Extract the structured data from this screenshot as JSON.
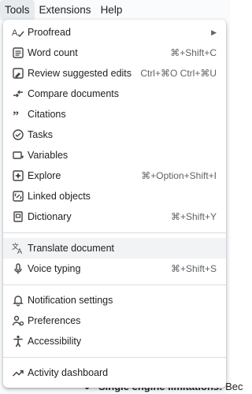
{
  "menubar": {
    "items": [
      "Tools",
      "Extensions",
      "Help"
    ]
  },
  "menu": {
    "items": [
      {
        "label": "Proofread",
        "shortcut": "",
        "submenu_glyph": "▶",
        "icon": "proofread-icon"
      },
      {
        "label": "Word count",
        "shortcut": "⌘+Shift+C",
        "icon": "word-count-icon"
      },
      {
        "label": "Review suggested edits",
        "shortcut": "Ctrl+⌘O Ctrl+⌘U",
        "icon": "review-edits-icon"
      },
      {
        "label": "Compare documents",
        "shortcut": "",
        "icon": "compare-icon"
      },
      {
        "label": "Citations",
        "shortcut": "",
        "icon": "quote-icon"
      },
      {
        "label": "Tasks",
        "shortcut": "",
        "icon": "tasks-check-icon"
      },
      {
        "label": "Variables",
        "shortcut": "",
        "icon": "variables-icon"
      },
      {
        "label": "Explore",
        "shortcut": "⌘+Option+Shift+I",
        "icon": "explore-icon"
      },
      {
        "label": "Linked objects",
        "shortcut": "",
        "icon": "linked-objects-icon"
      },
      {
        "label": "Dictionary",
        "shortcut": "⌘+Shift+Y",
        "icon": "dictionary-icon"
      },
      {
        "label": "Translate document",
        "shortcut": "",
        "icon": "translate-icon"
      },
      {
        "label": "Voice typing",
        "shortcut": "⌘+Shift+S",
        "icon": "microphone-icon"
      },
      {
        "label": "Notification settings",
        "shortcut": "",
        "icon": "bell-icon"
      },
      {
        "label": "Preferences",
        "shortcut": "",
        "icon": "preferences-icon"
      },
      {
        "label": "Accessibility",
        "shortcut": "",
        "icon": "accessibility-icon"
      },
      {
        "label": "Activity dashboard",
        "shortcut": "",
        "icon": "trending-icon"
      }
    ]
  },
  "document": {
    "bullet_bold": "Single engine limitations:",
    "bullet_rest": " Bec"
  },
  "colors": {
    "menubar_bg": "#f9fbfd",
    "menu_bg": "#ffffff",
    "hover_bg": "#f1f3f4",
    "separator": "#dadce0",
    "text": "#202124",
    "shortcut_text": "#5f6368"
  }
}
